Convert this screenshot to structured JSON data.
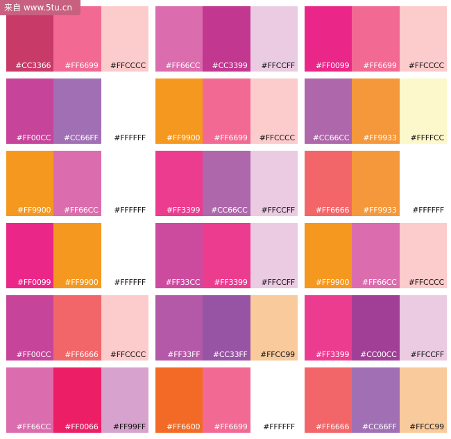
{
  "watermark": "来自 www.5tu.cn",
  "palettes": [
    [
      {
        "hex": "#CC3366",
        "fill": "#c83a68",
        "text": "dark"
      },
      {
        "hex": "#FF6699",
        "fill": "#f26a94",
        "text": "dark"
      },
      {
        "hex": "#FFCCCC",
        "fill": "#fccbcb",
        "text": "light"
      }
    ],
    [
      {
        "hex": "#FF66CC",
        "fill": "#db6cae",
        "text": "dark"
      },
      {
        "hex": "#CC3399",
        "fill": "#c2378f",
        "text": "dark"
      },
      {
        "hex": "#FFCCFF",
        "fill": "#eacbe2",
        "text": "light"
      }
    ],
    [
      {
        "hex": "#FF0099",
        "fill": "#ea2788",
        "text": "dark"
      },
      {
        "hex": "#FF6699",
        "fill": "#f26a94",
        "text": "dark"
      },
      {
        "hex": "#FFCCCC",
        "fill": "#fccbcb",
        "text": "light"
      }
    ],
    [
      {
        "hex": "#FF00CC",
        "fill": "#c7449b",
        "text": "dark"
      },
      {
        "hex": "#CC66FF",
        "fill": "#a16fb3",
        "text": "dark"
      },
      {
        "hex": "#FFFFFF",
        "fill": "#ffffff",
        "text": "light"
      }
    ],
    [
      {
        "hex": "#FF9900",
        "fill": "#f5981f",
        "text": "dark"
      },
      {
        "hex": "#FF6699",
        "fill": "#f26a94",
        "text": "dark"
      },
      {
        "hex": "#FFCCCC",
        "fill": "#fccbcb",
        "text": "light"
      }
    ],
    [
      {
        "hex": "#CC66CC",
        "fill": "#ae67ab",
        "text": "dark"
      },
      {
        "hex": "#FF9933",
        "fill": "#f5983b",
        "text": "dark"
      },
      {
        "hex": "#FFFFCC",
        "fill": "#fdf8cb",
        "text": "light"
      }
    ],
    [
      {
        "hex": "#FF9900",
        "fill": "#f5981f",
        "text": "dark"
      },
      {
        "hex": "#FF66CC",
        "fill": "#db6cae",
        "text": "dark"
      },
      {
        "hex": "#FFFFFF",
        "fill": "#ffffff",
        "text": "light"
      }
    ],
    [
      {
        "hex": "#FF3399",
        "fill": "#eb3c90",
        "text": "dark"
      },
      {
        "hex": "#CC66CC",
        "fill": "#ae67ab",
        "text": "dark"
      },
      {
        "hex": "#FFCCFF",
        "fill": "#eacbe2",
        "text": "light"
      }
    ],
    [
      {
        "hex": "#FF6666",
        "fill": "#f26669",
        "text": "dark"
      },
      {
        "hex": "#FF9933",
        "fill": "#f5983b",
        "text": "dark"
      },
      {
        "hex": "#FFFFFF",
        "fill": "#ffffff",
        "text": "light"
      }
    ],
    [
      {
        "hex": "#FF0099",
        "fill": "#ea2788",
        "text": "dark"
      },
      {
        "hex": "#FF9900",
        "fill": "#f5981f",
        "text": "dark"
      },
      {
        "hex": "#FFFFFF",
        "fill": "#ffffff",
        "text": "light"
      }
    ],
    [
      {
        "hex": "#FF33CC",
        "fill": "#cc4b9f",
        "text": "dark"
      },
      {
        "hex": "#FF3399",
        "fill": "#eb3c90",
        "text": "dark"
      },
      {
        "hex": "#FFCCFF",
        "fill": "#eacbe2",
        "text": "light"
      }
    ],
    [
      {
        "hex": "#FF9900",
        "fill": "#f5981f",
        "text": "dark"
      },
      {
        "hex": "#FF66CC",
        "fill": "#db6cae",
        "text": "dark"
      },
      {
        "hex": "#FFCCCC",
        "fill": "#fccbcb",
        "text": "light"
      }
    ],
    [
      {
        "hex": "#FF00CC",
        "fill": "#c7449b",
        "text": "dark"
      },
      {
        "hex": "#FF6666",
        "fill": "#f26669",
        "text": "dark"
      },
      {
        "hex": "#FFCCCC",
        "fill": "#fccbcb",
        "text": "light"
      }
    ],
    [
      {
        "hex": "#FF33FF",
        "fill": "#b458a8",
        "text": "dark"
      },
      {
        "hex": "#CC33FF",
        "fill": "#9854a4",
        "text": "dark"
      },
      {
        "hex": "#FFCC99",
        "fill": "#f9ca9c",
        "text": "light"
      }
    ],
    [
      {
        "hex": "#FF3399",
        "fill": "#eb3c90",
        "text": "dark"
      },
      {
        "hex": "#CC00CC",
        "fill": "#a03f95",
        "text": "dark"
      },
      {
        "hex": "#FFCCFF",
        "fill": "#eacbe2",
        "text": "light"
      }
    ],
    [
      {
        "hex": "#FF66CC",
        "fill": "#db6cae",
        "text": "dark"
      },
      {
        "hex": "#FF0066",
        "fill": "#ec1f66",
        "text": "dark"
      },
      {
        "hex": "#FF99FF",
        "fill": "#d7a3ce",
        "text": "light"
      }
    ],
    [
      {
        "hex": "#FF6600",
        "fill": "#f26a25",
        "text": "dark"
      },
      {
        "hex": "#FF6699",
        "fill": "#f26a94",
        "text": "dark"
      },
      {
        "hex": "#FFFFFF",
        "fill": "#ffffff",
        "text": "light"
      }
    ],
    [
      {
        "hex": "#FF6666",
        "fill": "#f26669",
        "text": "dark"
      },
      {
        "hex": "#CC66FF",
        "fill": "#a16fb3",
        "text": "dark"
      },
      {
        "hex": "#FFCC99",
        "fill": "#f9ca9c",
        "text": "light"
      }
    ]
  ]
}
